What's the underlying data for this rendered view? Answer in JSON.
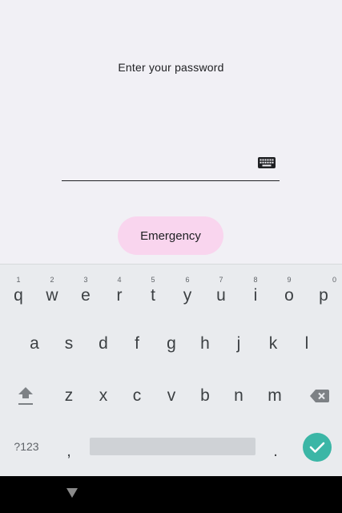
{
  "prompt": "Enter your password",
  "password_field": {
    "value": "",
    "placeholder": ""
  },
  "emergency_label": "Emergency",
  "keyboard": {
    "row1": [
      {
        "key": "q",
        "hint": "1"
      },
      {
        "key": "w",
        "hint": "2"
      },
      {
        "key": "e",
        "hint": "3"
      },
      {
        "key": "r",
        "hint": "4"
      },
      {
        "key": "t",
        "hint": "5"
      },
      {
        "key": "y",
        "hint": "6"
      },
      {
        "key": "u",
        "hint": "7"
      },
      {
        "key": "i",
        "hint": "8"
      },
      {
        "key": "o",
        "hint": "9"
      },
      {
        "key": "p",
        "hint": "0"
      }
    ],
    "row2": [
      "a",
      "s",
      "d",
      "f",
      "g",
      "h",
      "j",
      "k",
      "l"
    ],
    "row3": [
      "z",
      "x",
      "c",
      "v",
      "b",
      "n",
      "m"
    ],
    "symbols_label": "?123",
    "comma": ",",
    "period": "."
  },
  "colors": {
    "background": "#f1f0f5",
    "emergency_bg": "#f9d5ee",
    "keyboard_bg": "#e9ebee",
    "enter_key": "#3bb6a6",
    "navbar": "#000000"
  },
  "icons": {
    "keyboard_toggle": "keyboard-icon",
    "shift": "shift-icon",
    "backspace": "backspace-icon",
    "enter": "check-icon",
    "nav_back": "nav-back-icon"
  }
}
